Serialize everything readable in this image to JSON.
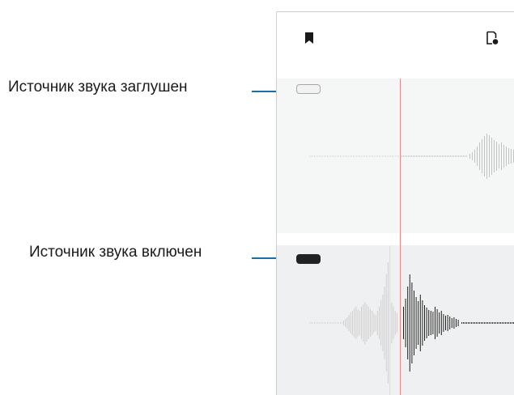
{
  "callouts": {
    "muted_label": "Источник звука заглушен",
    "active_label": "Источник звука включен"
  },
  "topbar": {
    "left_icon": "bookmark-icon",
    "right_icon": "bookmark-list-icon"
  },
  "tracks": {
    "muted_state": "muted",
    "active_state": "active"
  },
  "colors": {
    "callout_line": "#1b6ea8",
    "playhead": "#e58a8a",
    "active_chip": "#222222",
    "muted_chip": "#f2f2f2"
  }
}
